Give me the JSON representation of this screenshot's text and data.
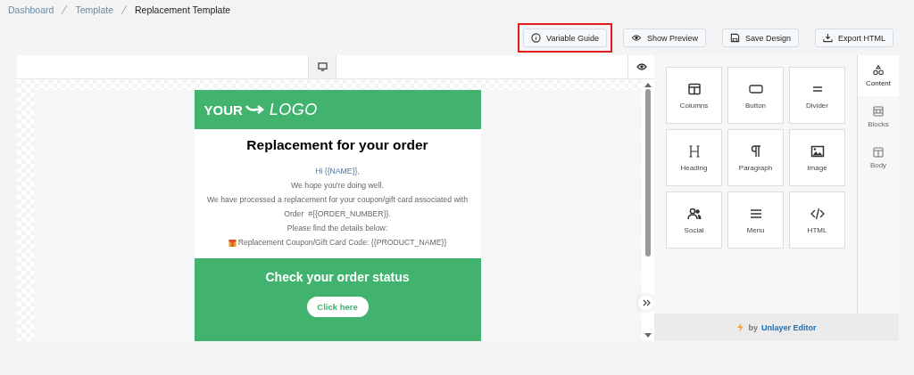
{
  "breadcrumb": [
    {
      "label": "Dashboard",
      "current": false
    },
    {
      "label": "Template",
      "current": false
    },
    {
      "label": "Replacement Template",
      "current": true
    }
  ],
  "actions": [
    {
      "kind": "info",
      "label": "Variable Guide",
      "highlighted": true
    },
    {
      "kind": "eye",
      "label": "Show Preview",
      "highlighted": false
    },
    {
      "kind": "save",
      "label": "Save Design",
      "highlighted": false
    },
    {
      "kind": "download",
      "label": "Export HTML",
      "highlighted": false
    }
  ],
  "email": {
    "logo": {
      "left": "YOUR",
      "right": "LOGO"
    },
    "title": "Replacement for your order",
    "lines": [
      {
        "text": "Hi {{NAME}},",
        "kind": "greeting"
      },
      {
        "text": "We hope you're doing well.",
        "kind": "plain"
      },
      {
        "text": "We have processed a replacement for your coupon/gift card associated with",
        "kind": "plain"
      },
      {
        "text": "Order  #{{ORDER_NUMBER}}.",
        "kind": "plain"
      },
      {
        "text": "Please find the details below:",
        "kind": "plain"
      },
      {
        "text": "Replacement Coupon/Gift Card Code: {{PRODUCT_NAME}}",
        "kind": "gift"
      }
    ],
    "cta": {
      "title": "Check your order status",
      "button": "Click here"
    }
  },
  "tools": [
    {
      "kind": "columns",
      "label": "Columns"
    },
    {
      "kind": "button",
      "label": "Button"
    },
    {
      "kind": "divider",
      "label": "Divider"
    },
    {
      "kind": "heading",
      "label": "Heading"
    },
    {
      "kind": "paragraph",
      "label": "Paragraph"
    },
    {
      "kind": "image",
      "label": "Image"
    },
    {
      "kind": "social",
      "label": "Social"
    },
    {
      "kind": "menu",
      "label": "Menu"
    },
    {
      "kind": "html",
      "label": "HTML"
    }
  ],
  "tabs": [
    {
      "kind": "content",
      "label": "Content",
      "selected": true
    },
    {
      "kind": "blocks",
      "label": "Blocks",
      "selected": false
    },
    {
      "kind": "body",
      "label": "Body",
      "selected": false
    }
  ],
  "footer": {
    "by": "by",
    "brand": "Unlayer Editor"
  }
}
